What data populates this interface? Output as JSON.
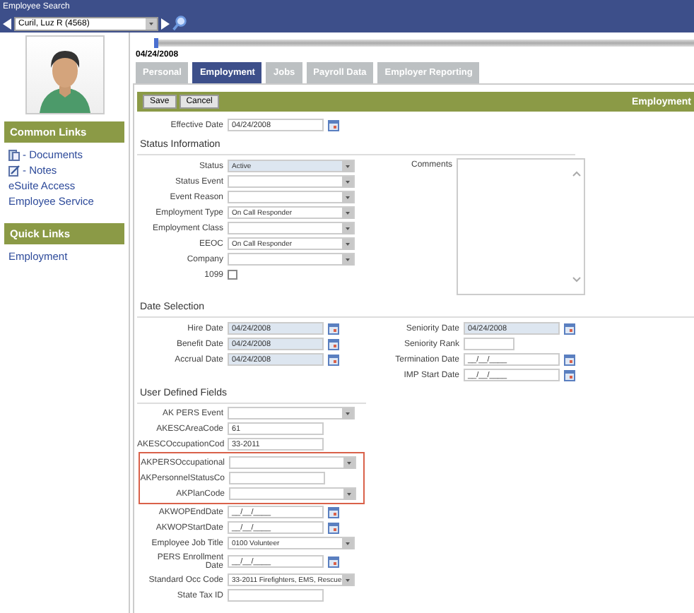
{
  "header": {
    "title": "Employee Search",
    "employee": "Curil, Luz R (4568)"
  },
  "timeline": {
    "level": 0,
    "date": "04/24/2008"
  },
  "sidebar": {
    "sections": [
      {
        "title": "Common Links",
        "links": [
          {
            "label": "- Documents",
            "kind": "documents"
          },
          {
            "label": "- Notes",
            "kind": "notes"
          },
          {
            "label": "eSuite Access",
            "kind": "plain"
          },
          {
            "label": "Employee Service",
            "kind": "plain"
          }
        ]
      },
      {
        "title": "Quick Links",
        "links": [
          {
            "label": "Employment",
            "kind": "plain"
          }
        ]
      }
    ]
  },
  "tabs": [
    {
      "label": "Personal",
      "selected": false
    },
    {
      "label": "Employment",
      "selected": true
    },
    {
      "label": "Jobs",
      "selected": false
    },
    {
      "label": "Payroll Data",
      "selected": false
    },
    {
      "label": "Employer Reporting",
      "selected": false
    }
  ],
  "toolbar": {
    "buttons": [
      "Save",
      "Cancel"
    ],
    "title": "Employment"
  },
  "effective_date": {
    "label": "Effective Date",
    "kind": "date",
    "value": "04/24/2008",
    "readonly": false
  },
  "status_information": {
    "title": "Status Information",
    "fields": [
      {
        "label": "Status",
        "kind": "select",
        "value": "Active",
        "readonly": true
      },
      {
        "label": "Status Event",
        "kind": "select",
        "readonly": false
      },
      {
        "label": "Event Reason",
        "kind": "select",
        "readonly": false
      },
      {
        "label": "Employment Type",
        "kind": "select",
        "value": "On Call Responder",
        "readonly": false
      },
      {
        "label": "Employment Class",
        "kind": "select",
        "readonly": false
      },
      {
        "label": "EEOC",
        "kind": "select",
        "value": "On Call Responder",
        "readonly": false
      },
      {
        "label": "Company",
        "kind": "select",
        "readonly": false
      },
      {
        "label": "1099",
        "kind": "checkbox",
        "checked": false
      }
    ],
    "comments": {
      "label": "Comments"
    }
  },
  "date_selection": {
    "title": "Date Selection",
    "left": [
      {
        "label": "Hire Date",
        "kind": "date",
        "value": "04/24/2008",
        "readonly": true
      },
      {
        "label": "Benefit Date",
        "kind": "date",
        "value": "04/24/2008",
        "readonly": true
      },
      {
        "label": "Accrual Date",
        "kind": "date",
        "value": "04/24/2008",
        "readonly": true
      }
    ],
    "right": [
      {
        "label": "Seniority Date",
        "kind": "date",
        "value": "04/24/2008",
        "readonly": true
      },
      {
        "label": "Seniority Rank",
        "kind": "short",
        "readonly": false
      },
      {
        "label": "Termination Date",
        "kind": "date",
        "value": "__/__/____",
        "readonly": false
      },
      {
        "label": "IMP Start Date",
        "kind": "date",
        "value": "__/__/____",
        "readonly": false
      }
    ]
  },
  "user_defined_fields": {
    "title": "User Defined Fields",
    "fields": [
      {
        "label": "AK PERS Event",
        "kind": "select",
        "readonly": false,
        "highlighted": false
      },
      {
        "label": "AKESCAreaCode",
        "kind": "text",
        "value": "61",
        "readonly": false,
        "highlighted": false
      },
      {
        "label": "AKESCOccupationCod",
        "kind": "text",
        "value": "33-2011",
        "readonly": false,
        "highlighted": false
      },
      {
        "label": "AKPERSOccupational",
        "kind": "select",
        "readonly": false,
        "highlighted": true
      },
      {
        "label": "AKPersonnelStatusCo",
        "kind": "text",
        "readonly": false,
        "highlighted": true
      },
      {
        "label": "AKPlanCode",
        "kind": "select",
        "readonly": false,
        "highlighted": true
      },
      {
        "label": "AKWOPEndDate",
        "kind": "date",
        "value": "__/__/____",
        "readonly": false,
        "highlighted": false
      },
      {
        "label": "AKWOPStartDate",
        "kind": "date",
        "value": "__/__/____",
        "readonly": false,
        "highlighted": false
      },
      {
        "label": "Employee Job Title",
        "kind": "select",
        "value": "0100 Volunteer",
        "readonly": false,
        "highlighted": false
      },
      {
        "label": "PERS Enrollment Date",
        "kind": "date",
        "value": "__/__/____",
        "readonly": false,
        "highlighted": false
      },
      {
        "label": "Standard Occ Code",
        "kind": "select",
        "value": "33-2011 Firefighters, EMS, Rescue",
        "readonly": false,
        "highlighted": false
      },
      {
        "label": "State Tax ID",
        "kind": "text",
        "readonly": false,
        "highlighted": false
      }
    ]
  }
}
